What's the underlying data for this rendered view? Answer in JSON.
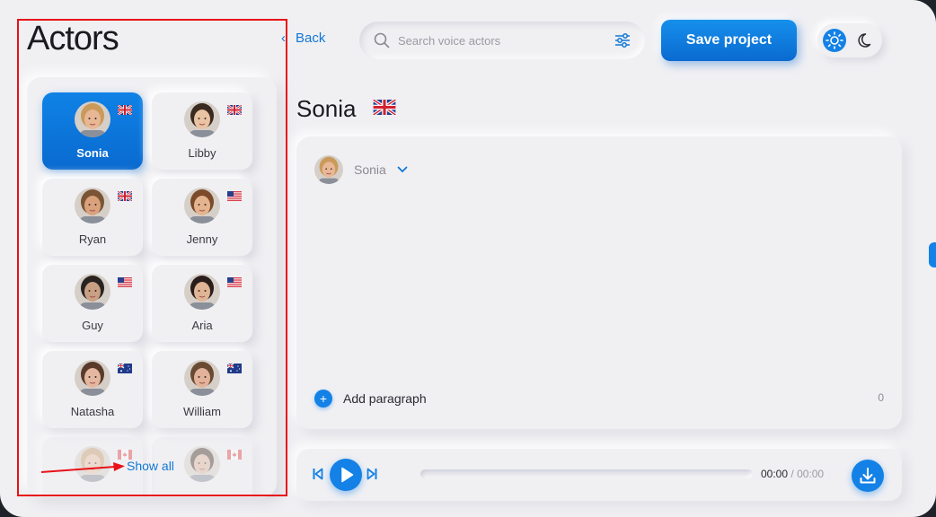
{
  "sidebar": {
    "title": "Actors",
    "show_all": "Show all",
    "actors": [
      {
        "name": "Sonia",
        "flag": "uk",
        "selected": true,
        "skin": "#e8b796",
        "hair": "#c99a5a"
      },
      {
        "name": "Libby",
        "flag": "uk",
        "selected": false,
        "skin": "#e9c3a2",
        "hair": "#3a2a20"
      },
      {
        "name": "Ryan",
        "flag": "uk",
        "selected": false,
        "skin": "#d9a27d",
        "hair": "#7a5535"
      },
      {
        "name": "Jenny",
        "flag": "us",
        "selected": false,
        "skin": "#e4b48f",
        "hair": "#7a4a2a"
      },
      {
        "name": "Guy",
        "flag": "us",
        "selected": false,
        "skin": "#caa085",
        "hair": "#2a2420"
      },
      {
        "name": "Aria",
        "flag": "us",
        "selected": false,
        "skin": "#e0b596",
        "hair": "#2a1e1a"
      },
      {
        "name": "Natasha",
        "flag": "au",
        "selected": false,
        "skin": "#e4b8a0",
        "hair": "#5a3a2a"
      },
      {
        "name": "William",
        "flag": "au",
        "selected": false,
        "skin": "#e2b29a",
        "hair": "#6a4a32"
      },
      {
        "name": "",
        "flag": "ca",
        "selected": false,
        "skin": "#e8c0a6",
        "hair": "#c8a070"
      },
      {
        "name": "",
        "flag": "ca",
        "selected": false,
        "skin": "#e0b8a0",
        "hair": "#4a3a30"
      }
    ]
  },
  "header": {
    "back_label": "Back",
    "search_placeholder": "Search voice actors",
    "save_label": "Save project"
  },
  "main": {
    "actor_name": "Sonia",
    "voice_select": "Sonia",
    "add_paragraph": "Add paragraph",
    "char_count": "0"
  },
  "player": {
    "current_time": "00:00",
    "separator": "/",
    "total_time": "00:00",
    "progress": 0
  },
  "colors": {
    "accent": "#1481e6",
    "annotation": "#e8121a"
  }
}
